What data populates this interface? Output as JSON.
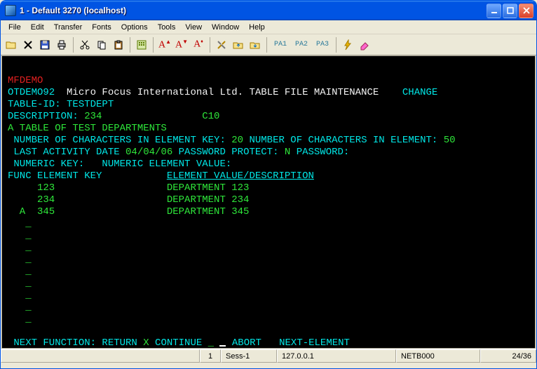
{
  "window": {
    "title": "1 - Default 3270 (localhost)"
  },
  "menu": [
    "File",
    "Edit",
    "Transfer",
    "Fonts",
    "Options",
    "Tools",
    "View",
    "Window",
    "Help"
  ],
  "toolbar": {
    "pa1": "PA1",
    "pa2": "PA2",
    "pa3": "PA3"
  },
  "screen": {
    "t1": "MFDEMO",
    "t2a": "OTDEMO92  ",
    "t2b": "Micro Focus International Ltd. TABLE FILE MAINTENANCE    ",
    "t2c": "CHANGE",
    "t3a": "TABLE-ID: ",
    "t3b": "TESTDEPT",
    "t4a": "DESCRIPTION: ",
    "t4b": "234                 C10",
    "t5": "A TABLE OF TEST DEPARTMENTS",
    "t6a": " NUMBER OF CHARACTERS IN ELEMENT KEY: ",
    "t6b": "20",
    "t6c": " NUMBER OF CHARACTERS IN ELEMENT: ",
    "t6d": "50",
    "t7a": " LAST ACTIVITY DATE ",
    "t7b": "04/04/06",
    "t7c": " PASSWORD PROTECT: ",
    "t7d": "N",
    "t7e": " PASSWORD:",
    "t8": " NUMERIC KEY:   NUMERIC ELEMENT VALUE:",
    "t9a": "FUNC ELEMENT KEY           ",
    "t9b": "ELEMENT VALUE/DESCRIPTION",
    "r1a": "     123                   ",
    "r1b": "DEPARTMENT 123",
    "r2a": "     234                   ",
    "r2b": "DEPARTMENT 234",
    "r3a": "  A  345                   ",
    "r3b": "DEPARTMENT 345",
    "dash": "   _",
    "nf1": " NEXT FUNCTION: ",
    "nf2": "RETURN ",
    "nf3": "X ",
    "nf4": "CONTINUE ",
    "nf5": "_ ",
    "nf6": " ABORT   ",
    "nf7": "NEXT-ELEMENT"
  },
  "status": {
    "sess_num": "1",
    "sess_name": "Sess-1",
    "ip": "127.0.0.1",
    "net": "NETB000",
    "cursor": "24/36"
  }
}
